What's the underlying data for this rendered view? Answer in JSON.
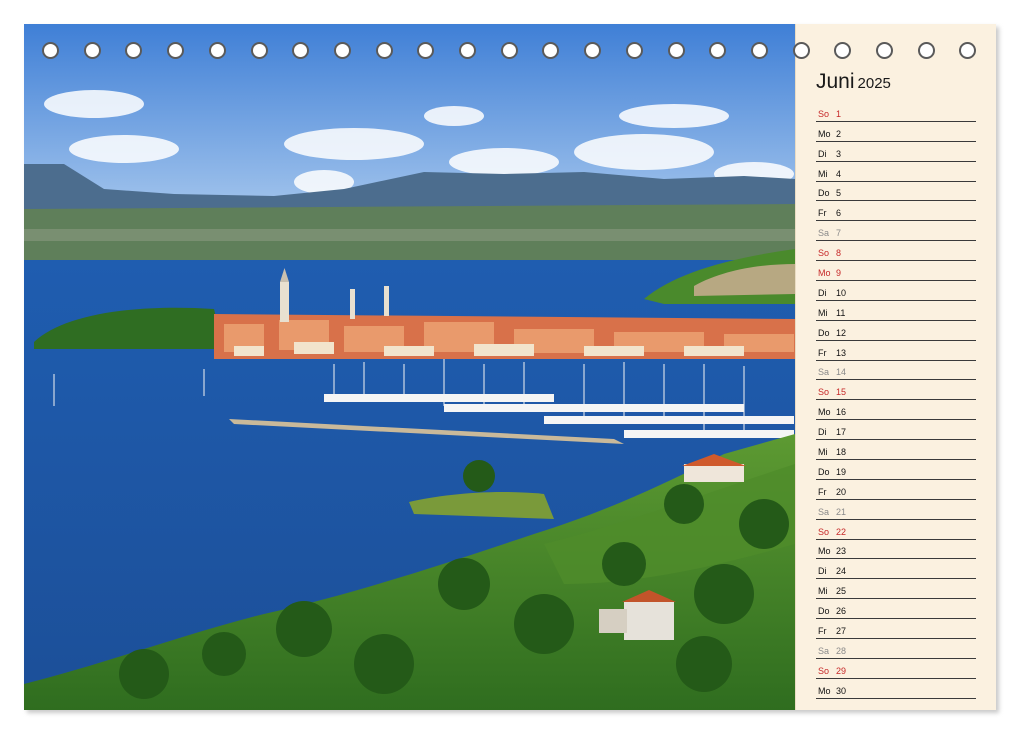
{
  "calendar": {
    "month": "Juni",
    "year": "2025",
    "days": [
      {
        "name": "So",
        "num": "1",
        "type": "sun"
      },
      {
        "name": "Mo",
        "num": "2",
        "type": "week"
      },
      {
        "name": "Di",
        "num": "3",
        "type": "week"
      },
      {
        "name": "Mi",
        "num": "4",
        "type": "week"
      },
      {
        "name": "Do",
        "num": "5",
        "type": "week"
      },
      {
        "name": "Fr",
        "num": "6",
        "type": "week"
      },
      {
        "name": "Sa",
        "num": "7",
        "type": "sat"
      },
      {
        "name": "So",
        "num": "8",
        "type": "sun"
      },
      {
        "name": "Mo",
        "num": "9",
        "type": "sun"
      },
      {
        "name": "Di",
        "num": "10",
        "type": "week"
      },
      {
        "name": "Mi",
        "num": "11",
        "type": "week"
      },
      {
        "name": "Do",
        "num": "12",
        "type": "week"
      },
      {
        "name": "Fr",
        "num": "13",
        "type": "week"
      },
      {
        "name": "Sa",
        "num": "14",
        "type": "sat"
      },
      {
        "name": "So",
        "num": "15",
        "type": "sun"
      },
      {
        "name": "Mo",
        "num": "16",
        "type": "week"
      },
      {
        "name": "Di",
        "num": "17",
        "type": "week"
      },
      {
        "name": "Mi",
        "num": "18",
        "type": "week"
      },
      {
        "name": "Do",
        "num": "19",
        "type": "week"
      },
      {
        "name": "Fr",
        "num": "20",
        "type": "week"
      },
      {
        "name": "Sa",
        "num": "21",
        "type": "sat"
      },
      {
        "name": "So",
        "num": "22",
        "type": "sun"
      },
      {
        "name": "Mo",
        "num": "23",
        "type": "week"
      },
      {
        "name": "Di",
        "num": "24",
        "type": "week"
      },
      {
        "name": "Mi",
        "num": "25",
        "type": "week"
      },
      {
        "name": "Do",
        "num": "26",
        "type": "week"
      },
      {
        "name": "Fr",
        "num": "27",
        "type": "week"
      },
      {
        "name": "Sa",
        "num": "28",
        "type": "sat"
      },
      {
        "name": "So",
        "num": "29",
        "type": "sun"
      },
      {
        "name": "Mo",
        "num": "30",
        "type": "week"
      }
    ]
  },
  "colors": {
    "holiday": "#c62828",
    "saturday": "#8a8a8a",
    "weekday": "#111111",
    "panel": "#fbf1e0"
  }
}
